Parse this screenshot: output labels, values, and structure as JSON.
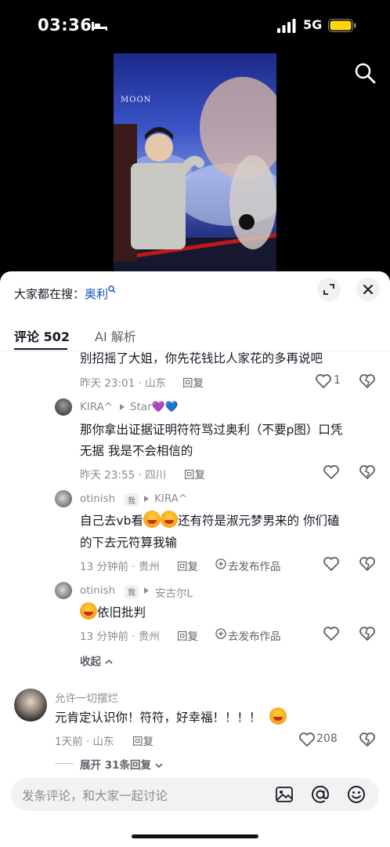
{
  "status_bar": {
    "time": "03:36",
    "network": "5G"
  },
  "video": {
    "overlay_text": "MOON"
  },
  "trend_bar": {
    "prefix": "大家都在搜：",
    "keyword": "奥利"
  },
  "tabs": [
    {
      "label": "评论 502",
      "active": true
    },
    {
      "label": "AI 解析",
      "active": false
    }
  ],
  "comments": [
    {
      "text": "别招摇了大姐，你先花钱比人家花的多再说吧",
      "meta": "昨天 23:01 · 山东",
      "reply": "回复",
      "likes": "1"
    },
    {
      "author": "KIRA^",
      "reply_to": "Star💜💙",
      "text_line1": "那你拿出证据证明符符骂过奥利（不要p图）口凭",
      "text_line2": "无据 我是不会相信的",
      "meta": "昨天 23:55 · 四川",
      "reply": "回复"
    },
    {
      "author": "otinish",
      "badge": "我",
      "reply_to": "KIRA^",
      "text_line1a": "自己去vb看",
      "text_line1b": "还有符是淑元梦男来的 你们磕",
      "text_line2": "的下去元符算我输",
      "meta": "13 分钟前 · 贵州",
      "reply": "回复",
      "publish": "去发布作品"
    },
    {
      "author": "otinish",
      "badge": "我",
      "reply_to": "安古尔L",
      "text": "依旧批判",
      "meta": "13 分钟前 · 贵州",
      "reply": "回复",
      "publish": "去发布作品"
    },
    {
      "collapse": "收起"
    },
    {
      "author": "允许一切摆烂",
      "text": "元肯定认识你！符符，好幸福！！！！",
      "meta": "1天前 · 山东",
      "reply": "回复",
      "likes": "208",
      "expand": "展开 31条回复"
    }
  ],
  "input": {
    "placeholder": "发条评论，和大家一起讨论"
  },
  "colors": {
    "keyword": "#0b4fbf",
    "text": "#161823",
    "meta": "#8a8b91"
  }
}
